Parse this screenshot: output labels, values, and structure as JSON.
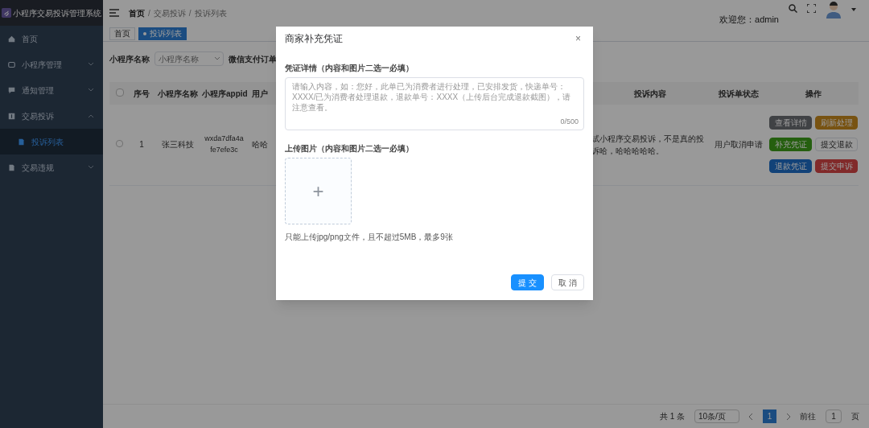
{
  "app": {
    "title": "小程序交易投诉管理系统"
  },
  "sidebar": {
    "items": [
      {
        "label": "首页",
        "selected": false
      },
      {
        "label": "小程序管理",
        "expanded": false,
        "selected": false
      },
      {
        "label": "通知管理",
        "expanded": false,
        "selected": false
      },
      {
        "label": "交易投诉",
        "expanded": true,
        "selected": false,
        "children": [
          {
            "label": "投诉列表",
            "selected": true
          }
        ]
      },
      {
        "label": "交易违规",
        "expanded": false,
        "selected": false
      }
    ]
  },
  "breadcrumb": {
    "items": [
      "首页",
      "交易投诉",
      "投诉列表"
    ],
    "separator": "/"
  },
  "header": {
    "welcome": "欢迎您：admin"
  },
  "tags": [
    {
      "label": "首页",
      "selected": false
    },
    {
      "label": "投诉列表",
      "selected": true
    }
  ],
  "filter": {
    "label": "小程序名称",
    "placeholder": "小程序名称",
    "label_2": "微信支付订单"
  },
  "table": {
    "select_all": false,
    "columns": [
      "序号",
      "小程序名称",
      "小程序appid",
      "用户",
      "投诉内容",
      "投诉单状态",
      "操作"
    ],
    "rows": [
      {
        "checked": false,
        "cells": [
          "1",
          "张三科技",
          "wxda7dfa4afe7efe3c",
          "哈哈",
          "试小程序交易投诉，不是真的投诉哈，哈哈哈哈哈。",
          "用户取消申请"
        ],
        "actions": [
          {
            "label": "查看详情",
            "kind": "info"
          },
          {
            "label": "刷新处理",
            "kind": "warning"
          },
          {
            "label": "补充凭证",
            "kind": "success"
          },
          {
            "label": "提交退款",
            "kind": "default"
          },
          {
            "label": "退款凭证",
            "kind": "primary"
          },
          {
            "label": "提交申诉",
            "kind": "danger"
          }
        ]
      }
    ]
  },
  "pagination": {
    "total": "共 1 条",
    "page_size": "10条/页",
    "pages": [
      {
        "label": "1",
        "selected": true
      }
    ],
    "goto": "前往",
    "goto_value": "1",
    "unit": "页"
  },
  "dialog": {
    "title": "商家补充凭证",
    "close": "×",
    "detail_label": "凭证详情（内容和图片二选一必填）",
    "detail_placeholder": "请输入内容，如：您好，此单已为消费者进行处理，已安排发货，快递单号：XXXX/已为消费者处理退款，退款单号：XXXX（上传后台完成退款截图），请注意查看。",
    "counter": "0/500",
    "upload_label": "上传图片（内容和图片二选一必填）",
    "upload_icon": "+",
    "hint": "只能上传jpg/png文件，且不超过5MB，最多9张",
    "buttons": [
      {
        "label": "提 交",
        "kind": "primary"
      },
      {
        "label": "取 消",
        "kind": "default"
      }
    ]
  }
}
